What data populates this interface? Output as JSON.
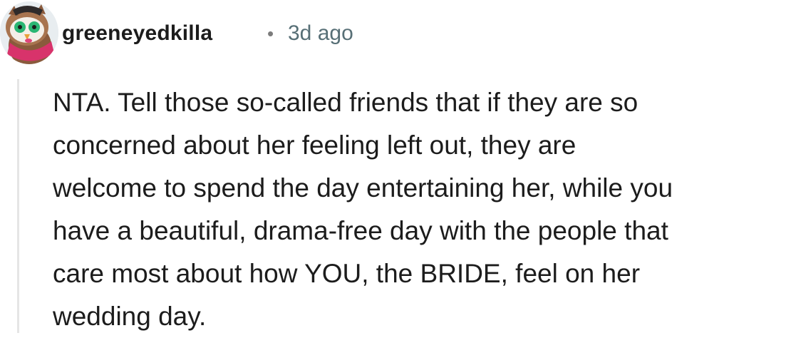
{
  "comment": {
    "author": "greeneyedkilla",
    "separator": "•",
    "timestamp": "3d ago",
    "avatar_icon": "owl-avatar-icon",
    "body_lines": [
      "NTA. Tell those so-called friends that if they are so",
      "concerned about her feeling left out, they are",
      "welcome to spend the day entertaining her, while you",
      "have a beautiful, drama-free day with the people that",
      "care most about how YOU, the BRIDE, feel on her",
      "wedding day."
    ]
  },
  "colors": {
    "text": "#1c1c1c",
    "meta": "#576f76",
    "thread_line": "#e5e5e5"
  }
}
